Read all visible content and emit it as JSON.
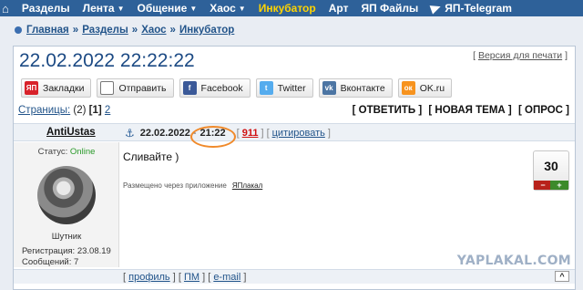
{
  "nav": {
    "items": [
      {
        "label": "Разделы",
        "caret": false,
        "highlight": false
      },
      {
        "label": "Лента",
        "caret": true,
        "highlight": false
      },
      {
        "label": "Общение",
        "caret": true,
        "highlight": false
      },
      {
        "label": "Хаос",
        "caret": true,
        "highlight": false
      },
      {
        "label": "Инкубатор",
        "caret": false,
        "highlight": true
      },
      {
        "label": "Арт",
        "caret": false,
        "highlight": false
      },
      {
        "label": "ЯП Файлы",
        "caret": false,
        "highlight": false
      },
      {
        "label": "ЯП-Telegram",
        "caret": false,
        "highlight": false
      }
    ],
    "highlight_color": "#ffd400",
    "bar_color": "#2e6199"
  },
  "breadcrumb": {
    "items": [
      "Главная",
      "Разделы",
      "Хаос",
      "Инкубатор"
    ],
    "separator": "»"
  },
  "post_title": "22.02.2022 22:22:22",
  "print_link": "Версия для печати",
  "share": [
    {
      "label": "Закладки",
      "icon": "yap-icon",
      "glyph": "ЯП"
    },
    {
      "label": "Отправить",
      "icon": "mail-icon",
      "glyph": "✉"
    },
    {
      "label": "Facebook",
      "icon": "facebook-icon",
      "glyph": "f"
    },
    {
      "label": "Twitter",
      "icon": "twitter-icon",
      "glyph": "t"
    },
    {
      "label": "Вконтакте",
      "icon": "vk-icon",
      "glyph": "vk"
    },
    {
      "label": "OK.ru",
      "icon": "ok-icon",
      "glyph": "ок"
    }
  ],
  "pages": {
    "label": "Страницы:",
    "count": "(2)",
    "current": "[1]",
    "next": "2"
  },
  "actions": [
    "[ ОТВЕТИТЬ ]",
    "[ НОВАЯ ТЕМА ]",
    "[ ОПРОС ]"
  ],
  "post": {
    "author": "AntiUstas",
    "date": "22.02.2022",
    "dash": "-",
    "time": "21:22",
    "number": "911",
    "quote": "цитировать",
    "status_label": "Статус:",
    "status_value": "Online",
    "user_title": "Шутник",
    "reg_label": "Регистрация:",
    "reg_date": "23.08.19",
    "msgs_label": "Сообщений:",
    "msgs_count": "7",
    "text": "Сливайте )",
    "posted_via": "Размещено через приложение",
    "app_name": "ЯПлакал",
    "rating": "30",
    "rating_minus": "−",
    "rating_plus": "+"
  },
  "footer": {
    "profile": "профиль",
    "pm": "ПМ",
    "email": "e-mail",
    "up": "^"
  },
  "watermark": "YAPLAKAL.COM"
}
